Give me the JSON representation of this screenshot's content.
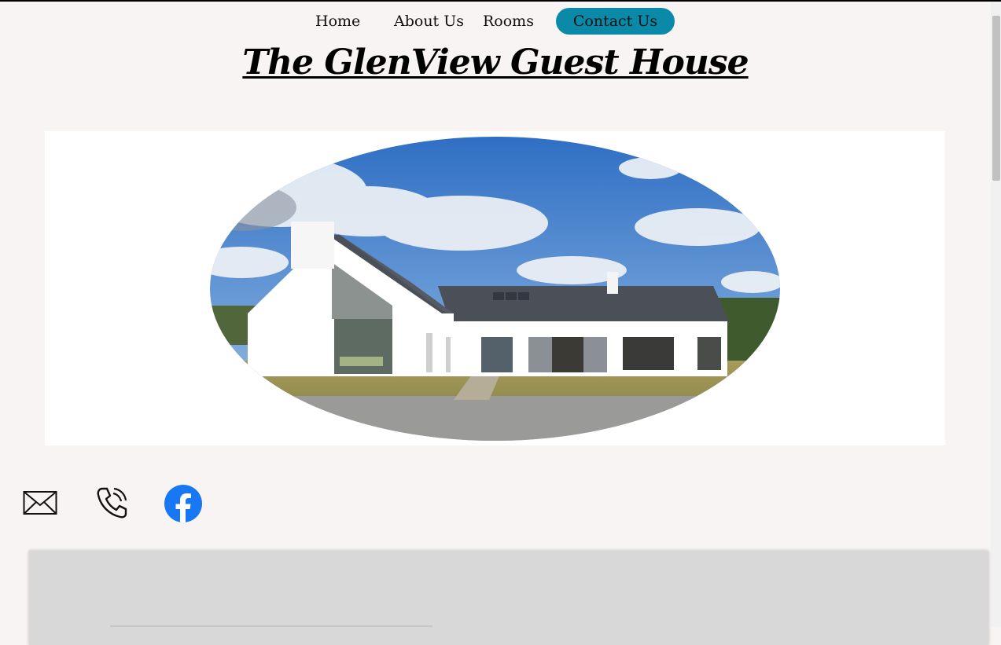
{
  "nav": {
    "items": [
      {
        "label": "Home"
      },
      {
        "label": "About Us"
      },
      {
        "label": "Rooms"
      },
      {
        "label": "Contact Us",
        "active": true
      }
    ],
    "active_color": "#0a8aa8"
  },
  "header": {
    "title": "The GlenView Guest House"
  },
  "hero": {
    "image_alt": "house-photo"
  },
  "social": {
    "icons": [
      "mail-icon",
      "phone-icon",
      "facebook-icon"
    ],
    "facebook_color": "#1877f2"
  },
  "colors": {
    "page_background": "#f7f4f3",
    "panel_background": "#d9d8d9"
  }
}
